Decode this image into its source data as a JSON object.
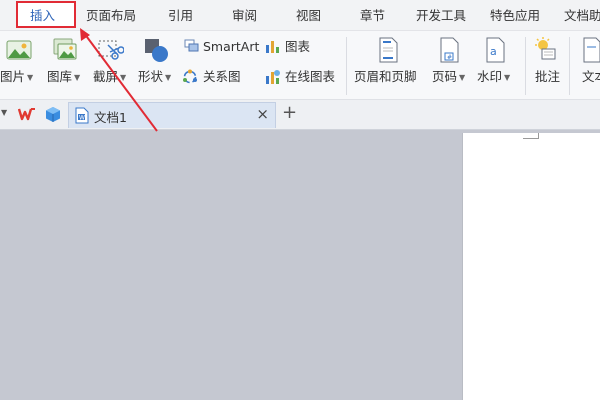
{
  "menu": {
    "tabs": [
      {
        "label": "插入",
        "active": true
      },
      {
        "label": "页面布局"
      },
      {
        "label": "引用"
      },
      {
        "label": "审阅"
      },
      {
        "label": "视图"
      },
      {
        "label": "章节"
      },
      {
        "label": "开发工具"
      },
      {
        "label": "特色应用"
      },
      {
        "label": "文档助"
      }
    ]
  },
  "ribbon": {
    "picture": "图片",
    "gallery": "图库",
    "screenshot": "截屏",
    "shape": "形状",
    "smartart": "SmartArt",
    "chart": "图表",
    "relation": "关系图",
    "online_chart": "在线图表",
    "header_footer": "页眉和页脚",
    "page_number": "页码",
    "watermark": "水印",
    "comment": "批注",
    "textbox": "文本"
  },
  "doc_tabs": {
    "name": "文档1",
    "close": "×",
    "new": "+"
  },
  "colors": {
    "accent": "#2f65b9",
    "highlight": "#e12b35",
    "workspace": "#c5c8d1"
  }
}
